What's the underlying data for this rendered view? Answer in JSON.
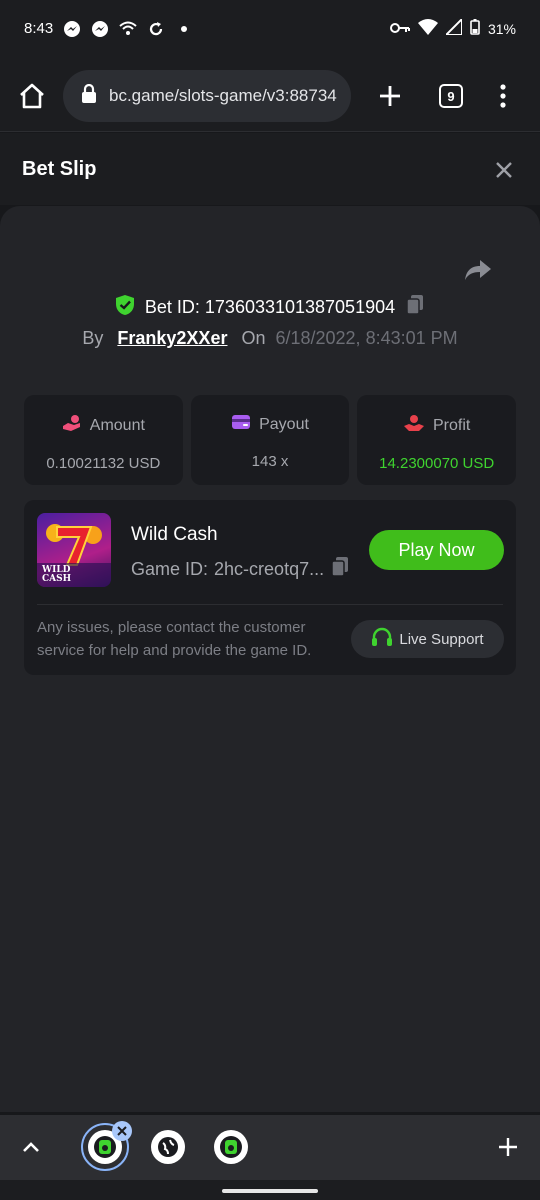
{
  "status_bar": {
    "time": "8:43",
    "battery": "31%"
  },
  "browser": {
    "url": "bc.game/slots-game/v3:88734",
    "tab_count": "9"
  },
  "bet_slip": {
    "title": "Bet Slip",
    "bet_id_label": "Bet ID:",
    "bet_id": "1736033101387051904",
    "by_label": "By",
    "username": "Franky2XXer",
    "on_label": "On",
    "date": "6/18/2022, 8:43:01 PM"
  },
  "stats": [
    {
      "label": "Amount",
      "value": "0.10021132 USD",
      "icon": "hand-coins-icon",
      "color": "#ef4f7a"
    },
    {
      "label": "Payout",
      "value": "143 x",
      "icon": "wallet-icon",
      "color": "#a95df0"
    },
    {
      "label": "Profit",
      "value": "14.2300070 USD",
      "icon": "hand-money-icon",
      "color": "#e8414b",
      "value_color": "#3fd32f"
    }
  ],
  "game": {
    "name": "Wild Cash",
    "id_label": "Game ID:",
    "id_value": "2hc-creotq7...",
    "play_label": "Play Now",
    "thumb_text": "WILD CASH",
    "help_text": "Any issues, please contact the customer service for help and provide the game ID.",
    "live_support_label": "Live Support"
  },
  "colors": {
    "accent_green": "#40bd1b",
    "profit_green": "#3fd32f",
    "shield_green": "#3fd32f"
  }
}
